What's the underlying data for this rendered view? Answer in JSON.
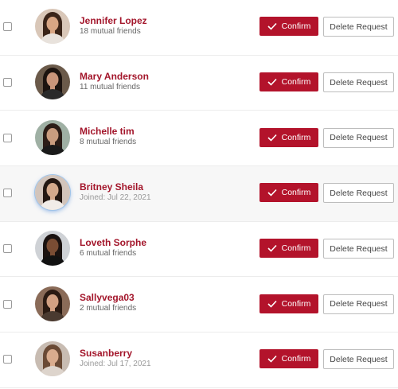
{
  "labels": {
    "confirm": "Confirm",
    "delete": "Delete Request"
  },
  "colors": {
    "accent": "#b3132b",
    "name": "#a3162b"
  },
  "requests": [
    {
      "name": "Jennifer Lopez",
      "detail": "18 mutual friends",
      "avatar": {
        "bg": "#d9c7b8",
        "skin": "#d8a684",
        "hair": "#3a2418",
        "top": "#e8e2dc"
      }
    },
    {
      "name": "Mary Anderson",
      "detail": "11 mutual friends",
      "avatar": {
        "bg": "#6b5a4a",
        "skin": "#c9957a",
        "hair": "#1c130f",
        "top": "#2a2a2a"
      }
    },
    {
      "name": "Michelle tim",
      "detail": "8 mutual friends",
      "avatar": {
        "bg": "#9fb0a4",
        "skin": "#c99d7f",
        "hair": "#2b1d17",
        "top": "#1a1a1a"
      }
    },
    {
      "name": "Britney Sheila",
      "detail": "Joined: Jul 22, 2021",
      "avatar": {
        "bg": "#d2c4bb",
        "skin": "#d4a98c",
        "hair": "#241712",
        "top": "#f1ece8"
      }
    },
    {
      "name": "Loveth Sorphe",
      "detail": "6 mutual friends",
      "avatar": {
        "bg": "#cfd2d6",
        "skin": "#7a4d34",
        "hair": "#1a1210",
        "top": "#111111"
      }
    },
    {
      "name": "Sallyvega03",
      "detail": "2 mutual friends",
      "avatar": {
        "bg": "#8a6b58",
        "skin": "#d2a183",
        "hair": "#2a1a12",
        "top": "#4a3a30"
      }
    },
    {
      "name": "Susanberry",
      "detail": "Joined: Jul 17, 2021",
      "avatar": {
        "bg": "#c8bcb2",
        "skin": "#d9ac8e",
        "hair": "#6a4a35",
        "top": "#ddd4cc"
      }
    }
  ]
}
